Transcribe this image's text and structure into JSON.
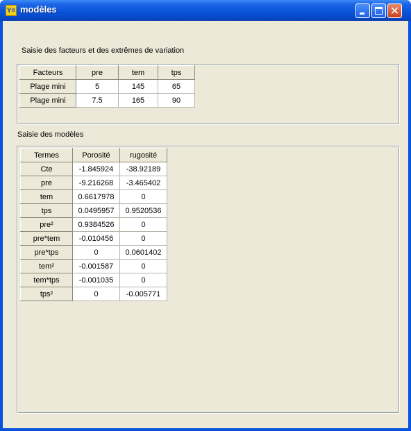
{
  "window": {
    "title": "modèles",
    "icon": "app-icon",
    "icon_text": "Y="
  },
  "factors_section": {
    "label": "Saisie des facteurs et des extrêmes de variation",
    "header": [
      "Facteurs",
      "pre",
      "tem",
      "tps"
    ],
    "rows": [
      [
        "Plage mini",
        "5",
        "145",
        "65"
      ],
      [
        "Plage mini",
        "7.5",
        "165",
        "90"
      ]
    ]
  },
  "models_section": {
    "label": "Saisie des modèles",
    "header": [
      "Termes",
      "Porosité",
      "rugosité"
    ],
    "rows": [
      [
        "Cte",
        "-1.845924",
        "-38.92189"
      ],
      [
        "pre",
        "-9.216268",
        "-3.465402"
      ],
      [
        "tem",
        "0.6617978",
        "0"
      ],
      [
        "tps",
        "0.0495957",
        "0.9520536"
      ],
      [
        "pre²",
        "0.9384526",
        "0"
      ],
      [
        "pre*tem",
        "-0.010456",
        "0"
      ],
      [
        "pre*tps",
        "0",
        "0.0601402"
      ],
      [
        "tem²",
        "-0.001587",
        "0"
      ],
      [
        "tem*tps",
        "-0.001035",
        "0"
      ],
      [
        "tps²",
        "0",
        "-0.005771"
      ]
    ]
  },
  "colors": {
    "titlebar": "#0a55dc",
    "client_bg": "#ece9d8",
    "close_button": "#c8401a"
  }
}
